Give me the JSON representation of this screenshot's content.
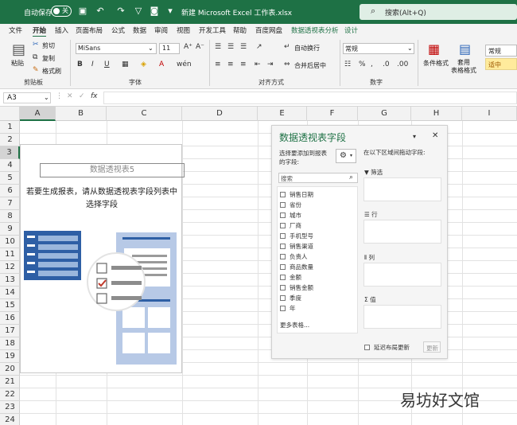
{
  "titlebar": {
    "autosave": "自动保存",
    "toggle": "关",
    "title": "新建 Microsoft Excel 工作表.xlsx",
    "search_placeholder": "搜索(Alt+Q)"
  },
  "menu": [
    "文件",
    "开始",
    "插入",
    "页面布局",
    "公式",
    "数据",
    "审阅",
    "视图",
    "开发工具",
    "帮助",
    "百度网盘",
    "数据透视表分析",
    "设计"
  ],
  "ribbon": {
    "clipboard": {
      "paste": "粘贴",
      "cut": "剪切",
      "copy": "复制",
      "format_painter": "格式刷",
      "label": "剪贴板"
    },
    "font": {
      "name": "MiSans",
      "size": "11",
      "label": "字体"
    },
    "alignment": {
      "wrap": "自动换行",
      "merge": "合并后居中",
      "label": "对齐方式"
    },
    "number": {
      "format": "常规",
      "label": "数字"
    },
    "styles": {
      "conditional": "条件格式",
      "table_format_1": "套用",
      "table_format_2": "表格格式",
      "normal": "常规",
      "neutral": "适中"
    }
  },
  "formula_bar": {
    "name_box": "A3",
    "fx": "fx"
  },
  "columns": [
    "A",
    "B",
    "C",
    "D",
    "E",
    "F",
    "G",
    "H",
    "I"
  ],
  "rows": [
    "1",
    "2",
    "3",
    "4",
    "5",
    "6",
    "7",
    "8",
    "9",
    "10",
    "11",
    "12",
    "13",
    "14",
    "15",
    "16",
    "17",
    "18",
    "19",
    "20",
    "21",
    "22",
    "23",
    "24"
  ],
  "pivot_placeholder": {
    "name": "数据透视表5",
    "message": "若要生成报表，请从数据透视表字段列表中选择字段"
  },
  "pane": {
    "title": "数据透视表字段",
    "choose_label_1": "选择要添加到报表",
    "choose_label_2": "的字段:",
    "drag_label": "在以下区域间拖动字段:",
    "search_placeholder": "搜索",
    "fields": [
      "销售日期",
      "省份",
      "城市",
      "厂商",
      "手机型号",
      "销售渠道",
      "负责人",
      "商品数量",
      "金额",
      "销售金额",
      "季度",
      "年"
    ],
    "more_tables": "更多表格...",
    "areas": {
      "filter": "筛选",
      "rows": "行",
      "columns": "列",
      "values": "值"
    },
    "defer": "延迟布局更新",
    "update": "更新"
  },
  "watermark": "易坊好文馆",
  "colors": {
    "accent": "#1e7145",
    "neutral_fill": "#ffeb9c",
    "neutral_text": "#9c5700"
  }
}
